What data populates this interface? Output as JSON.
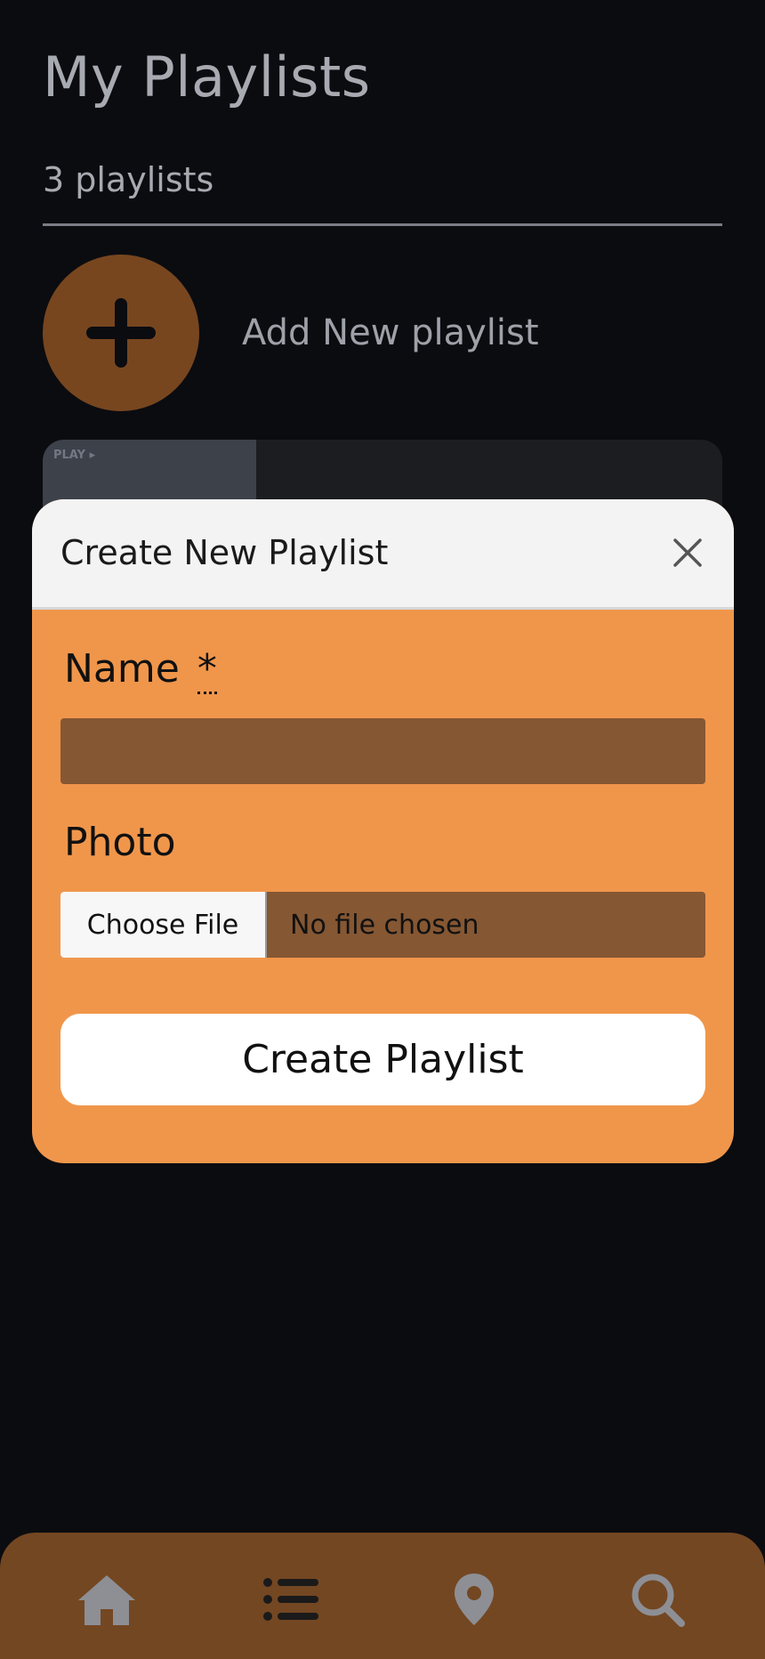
{
  "header": {
    "title": "My Playlists",
    "count_text": "3 playlists"
  },
  "add_playlist": {
    "label": "Add New playlist",
    "icon": "plus-icon"
  },
  "playlist_card": {
    "thumbnail_text": "PLAY ▸"
  },
  "modal": {
    "title": "Create New Playlist",
    "close_icon": "close-icon",
    "name_label": "Name",
    "required_mark": "*",
    "name_value": "",
    "photo_label": "Photo",
    "choose_file_label": "Choose File",
    "file_status": "No file chosen",
    "submit_label": "Create Playlist"
  },
  "bottom_nav": {
    "items": [
      {
        "icon": "home-icon"
      },
      {
        "icon": "list-icon"
      },
      {
        "icon": "location-pin-icon"
      },
      {
        "icon": "search-icon"
      }
    ]
  },
  "colors": {
    "background": "#0b0c10",
    "accent_orange": "#f0964b",
    "input_brown": "#855733",
    "nav_brown": "#734722",
    "add_circle": "#77461f"
  }
}
